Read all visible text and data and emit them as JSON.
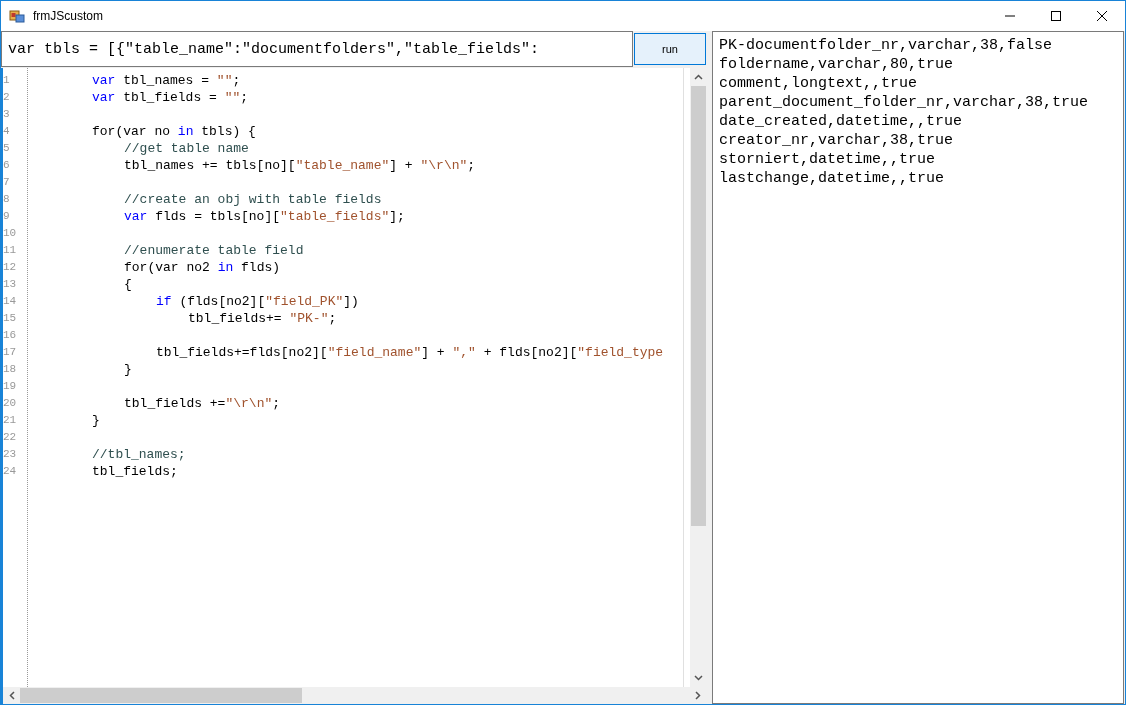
{
  "window": {
    "title": "frmJScustom"
  },
  "script_input": {
    "value": "var tbls = [{\"table_name\":\"documentfolders\",\"table_fields\":"
  },
  "run_button": {
    "label": "run"
  },
  "editor": {
    "lines": [
      {
        "n": "1",
        "tokens": [
          {
            "kind": "keyword",
            "t": "var"
          },
          {
            "kind": "plain",
            "t": " tbl_names = "
          },
          {
            "kind": "string",
            "t": "\"\""
          },
          {
            "kind": "plain",
            "t": ";"
          }
        ]
      },
      {
        "n": "2",
        "tokens": [
          {
            "kind": "keyword",
            "t": "var"
          },
          {
            "kind": "plain",
            "t": " tbl_fields = "
          },
          {
            "kind": "string",
            "t": "\"\""
          },
          {
            "kind": "plain",
            "t": ";"
          }
        ]
      },
      {
        "n": "3"
      },
      {
        "n": "4",
        "tokens": [
          {
            "kind": "plain",
            "t": "for(var no "
          },
          {
            "kind": "keyword",
            "t": "in"
          },
          {
            "kind": "plain",
            "t": " tbls) {"
          }
        ],
        "children": [
          {
            "n": "5",
            "tokens": [
              {
                "kind": "comment",
                "t": "//get table name"
              }
            ]
          },
          {
            "n": "6",
            "tokens": [
              {
                "kind": "plain",
                "t": "tbl_names += tbls[no]["
              },
              {
                "kind": "string",
                "t": "\"table_name\""
              },
              {
                "kind": "plain",
                "t": "] + "
              },
              {
                "kind": "string",
                "t": "\"\\r\\n\""
              },
              {
                "kind": "plain",
                "t": ";"
              }
            ]
          },
          {
            "n": "7"
          },
          {
            "n": "8",
            "tokens": [
              {
                "kind": "comment",
                "t": "//create an obj with table fields"
              }
            ]
          },
          {
            "n": "9",
            "tokens": [
              {
                "kind": "keyword",
                "t": "var"
              },
              {
                "kind": "plain",
                "t": " flds = tbls[no]["
              },
              {
                "kind": "string",
                "t": "\"table_fields\""
              },
              {
                "kind": "plain",
                "t": "];"
              }
            ]
          },
          {
            "n": "10"
          },
          {
            "n": "11",
            "tokens": [
              {
                "kind": "comment",
                "t": "//enumerate table field"
              }
            ]
          },
          {
            "n": "12",
            "tokens": [
              {
                "kind": "plain",
                "t": "for(var no2 "
              },
              {
                "kind": "keyword",
                "t": "in"
              },
              {
                "kind": "plain",
                "t": " flds)"
              }
            ]
          },
          {
            "n": "13",
            "tokens": [
              {
                "kind": "plain",
                "t": "{"
              }
            ],
            "children": [
              {
                "n": "14",
                "tokens": [
                  {
                    "kind": "keyword",
                    "t": "if"
                  },
                  {
                    "kind": "plain",
                    "t": " (flds[no2]["
                  },
                  {
                    "kind": "string",
                    "t": "\"field_PK\""
                  },
                  {
                    "kind": "plain",
                    "t": "])"
                  }
                ],
                "children": [
                  {
                    "n": "15",
                    "tokens": [
                      {
                        "kind": "plain",
                        "t": "tbl_fields+= "
                      },
                      {
                        "kind": "string",
                        "t": "\"PK-\""
                      },
                      {
                        "kind": "plain",
                        "t": ";"
                      }
                    ]
                  }
                ]
              },
              {
                "n": "16"
              },
              {
                "n": "17",
                "tokens": [
                  {
                    "kind": "plain",
                    "t": "tbl_fields+=flds[no2]["
                  },
                  {
                    "kind": "string",
                    "t": "\"field_name\""
                  },
                  {
                    "kind": "plain",
                    "t": "] + "
                  },
                  {
                    "kind": "string",
                    "t": "\",\""
                  },
                  {
                    "kind": "plain",
                    "t": " + flds[no2]["
                  },
                  {
                    "kind": "string",
                    "t": "\"field_type"
                  }
                ]
              }
            ]
          },
          {
            "n": "18",
            "tokens": [
              {
                "kind": "plain",
                "t": "}"
              }
            ]
          },
          {
            "n": "19"
          },
          {
            "n": "20",
            "tokens": [
              {
                "kind": "plain",
                "t": "tbl_fields +="
              },
              {
                "kind": "string",
                "t": "\"\\r\\n\""
              },
              {
                "kind": "plain",
                "t": ";"
              }
            ]
          }
        ]
      },
      {
        "n": "21",
        "tokens": [
          {
            "kind": "plain",
            "t": "}"
          }
        ]
      },
      {
        "n": "22"
      },
      {
        "n": "23",
        "tokens": [
          {
            "kind": "comment",
            "t": "//tbl_names;"
          }
        ]
      },
      {
        "n": "24",
        "tokens": [
          {
            "kind": "plain",
            "t": "tbl_fields;"
          }
        ]
      }
    ]
  },
  "output": {
    "lines": [
      "PK-documentfolder_nr,varchar,38,false",
      "foldername,varchar,80,true",
      "comment,longtext,,true",
      "parent_document_folder_nr,varchar,38,true",
      "date_created,datetime,,true",
      "creator_nr,varchar,38,true",
      "storniert,datetime,,true",
      "lastchange,datetime,,true"
    ]
  }
}
